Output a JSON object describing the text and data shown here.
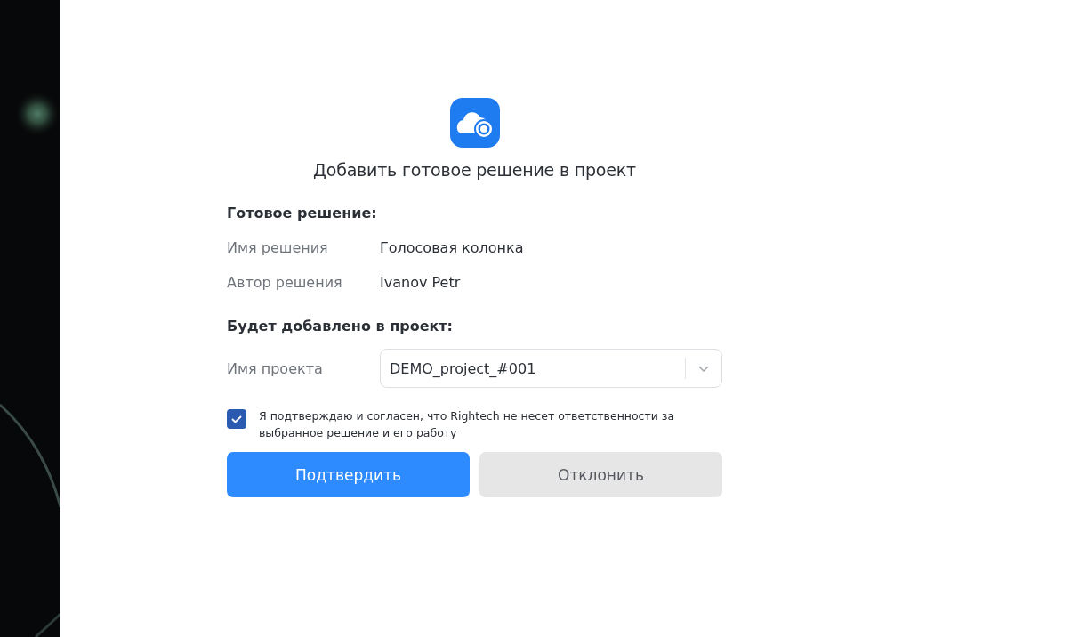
{
  "dialog": {
    "title": "Добавить готовое решение в проект",
    "solution_section": {
      "heading": "Готовое решение:",
      "rows": [
        {
          "label": "Имя решения",
          "value": "Голосовая колонка"
        },
        {
          "label": "Автор решения",
          "value": "Ivanov Petr"
        }
      ]
    },
    "project_section": {
      "heading": "Будет добавлено в проект:",
      "field": {
        "label": "Имя проекта",
        "value": "DEMO_project_#001"
      }
    },
    "agreement": {
      "checked": true,
      "text": "Я подтверждаю и согласен, что Rightech не несет ответственности за выбранное решение и его работу"
    },
    "buttons": [
      {
        "label": "Подтвердить",
        "kind": "primary"
      },
      {
        "label": "Отклонить",
        "kind": "secondary"
      }
    ]
  }
}
